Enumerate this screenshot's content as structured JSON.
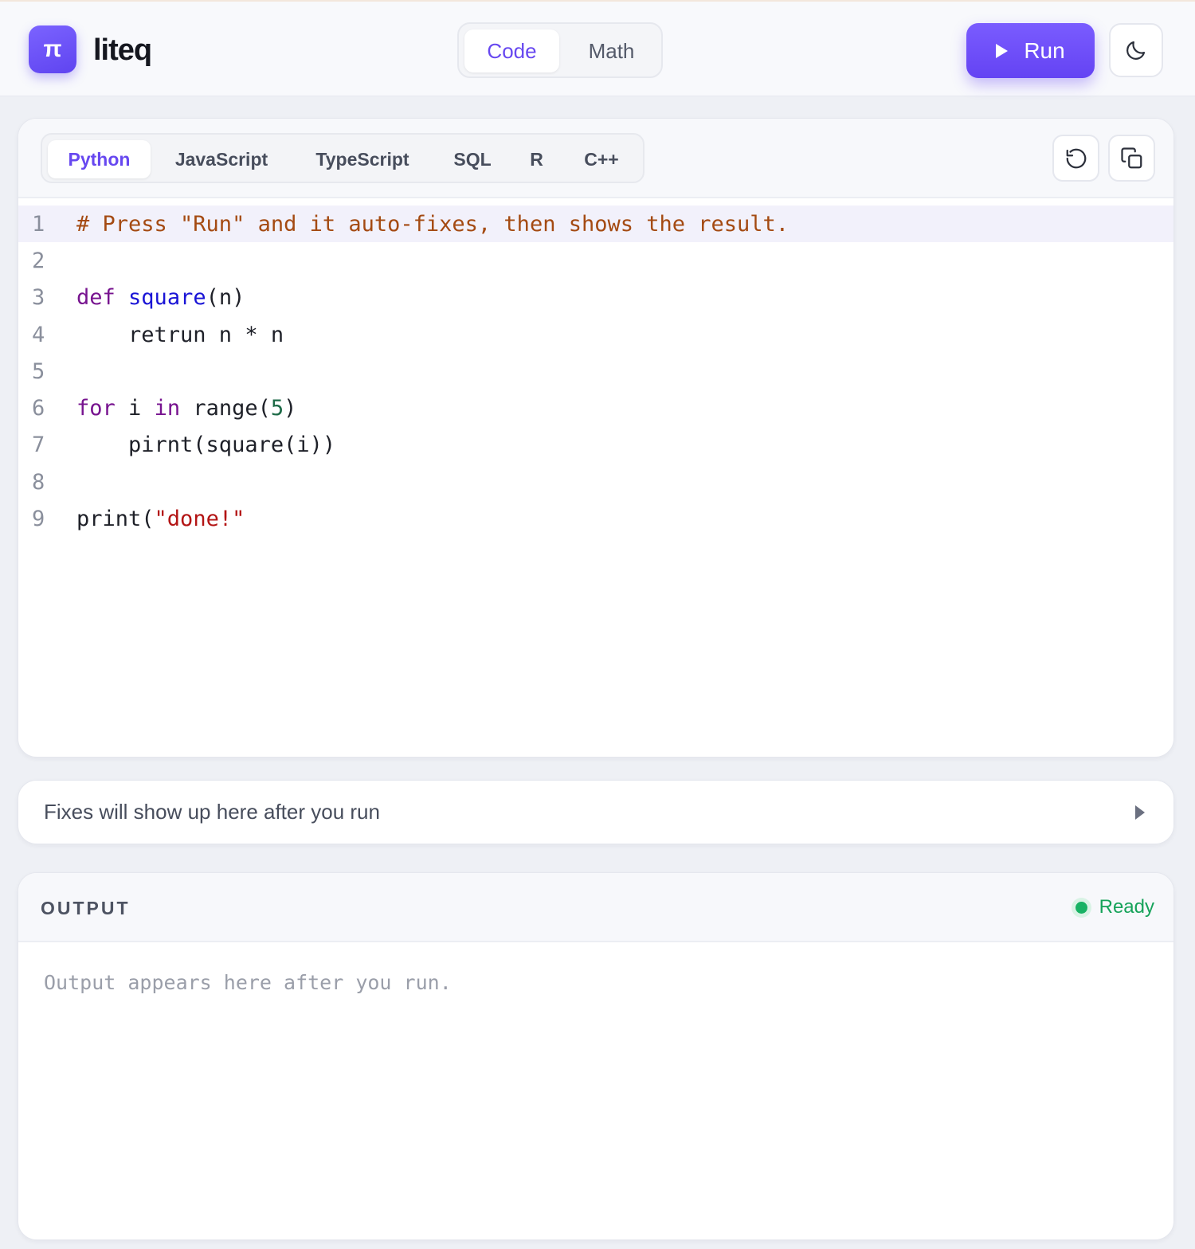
{
  "app": {
    "logo_glyph": "π",
    "name": "liteq"
  },
  "mode_tabs": [
    {
      "label": "Code",
      "active": true
    },
    {
      "label": "Math",
      "active": false
    }
  ],
  "run_button": {
    "label": "Run"
  },
  "theme_toggle": {
    "icon": "moon-icon"
  },
  "editor": {
    "language_tabs": [
      {
        "label": "Python",
        "active": true
      },
      {
        "label": "JavaScript",
        "active": false
      },
      {
        "label": "TypeScript",
        "active": false
      },
      {
        "label": "SQL",
        "active": false
      },
      {
        "label": "R",
        "active": false
      },
      {
        "label": "C++",
        "active": false
      }
    ],
    "actions": [
      {
        "icon": "reset-icon"
      },
      {
        "icon": "copy-icon"
      }
    ],
    "active_line": 1,
    "lines": [
      {
        "number": "1",
        "tokens": [
          {
            "type": "comment",
            "text": "# Press \"Run\" and it auto-fixes, then shows the result."
          }
        ]
      },
      {
        "number": "2",
        "tokens": []
      },
      {
        "number": "3",
        "tokens": [
          {
            "type": "kw",
            "text": "def"
          },
          {
            "type": "plain",
            "text": " "
          },
          {
            "type": "fn",
            "text": "square"
          },
          {
            "type": "plain",
            "text": "(n)"
          }
        ]
      },
      {
        "number": "4",
        "tokens": [
          {
            "type": "plain",
            "text": "    retrun n * n"
          }
        ]
      },
      {
        "number": "5",
        "tokens": []
      },
      {
        "number": "6",
        "tokens": [
          {
            "type": "kw",
            "text": "for"
          },
          {
            "type": "plain",
            "text": " i "
          },
          {
            "type": "kw",
            "text": "in"
          },
          {
            "type": "plain",
            "text": " range("
          },
          {
            "type": "num",
            "text": "5"
          },
          {
            "type": "plain",
            "text": ")"
          }
        ]
      },
      {
        "number": "7",
        "tokens": [
          {
            "type": "plain",
            "text": "    pirnt(square(i))"
          }
        ]
      },
      {
        "number": "8",
        "tokens": []
      },
      {
        "number": "9",
        "tokens": [
          {
            "type": "plain",
            "text": "print("
          },
          {
            "type": "str",
            "text": "\"done!\""
          }
        ]
      }
    ]
  },
  "fixes": {
    "text": "Fixes will show up here after you run"
  },
  "output": {
    "title": "OUTPUT",
    "status": "Ready",
    "status_color": "#16a35a",
    "placeholder": "Output appears here after you run."
  },
  "colors": {
    "accent": "#6748f0",
    "comment": "#a44a12",
    "keyword": "#77138f",
    "function": "#1a14d6",
    "number": "#1d6a47",
    "string": "#b31414"
  }
}
